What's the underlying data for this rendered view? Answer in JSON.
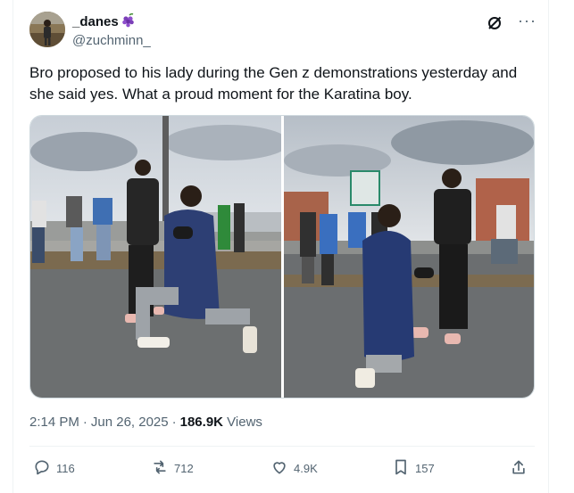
{
  "author": {
    "display_name": "_danes",
    "emoji": "grape-icon",
    "handle": "@zuchminn_"
  },
  "tweet": {
    "text": "Bro proposed to his lady during the Gen z demonstrations yesterday and she said yes. What a proud moment for the Karatina boy."
  },
  "meta": {
    "time": "2:14 PM",
    "separator": "·",
    "date": "Jun 26, 2025",
    "views_count": "186.9K",
    "views_label": "Views"
  },
  "actions": {
    "replies": "116",
    "reposts": "712",
    "likes": "4.9K",
    "bookmarks": "157"
  },
  "icons": {
    "grok": "grok-slash-icon",
    "more": "more-dots-icon",
    "reply": "reply-bubble-icon",
    "repost": "repost-arrows-icon",
    "like": "heart-icon",
    "bookmark": "bookmark-icon",
    "share": "share-upload-icon"
  },
  "colors": {
    "text_primary": "#0f1419",
    "text_secondary": "#536471",
    "border": "#eff3f4",
    "emoji_purple": "#7b3fb8"
  }
}
